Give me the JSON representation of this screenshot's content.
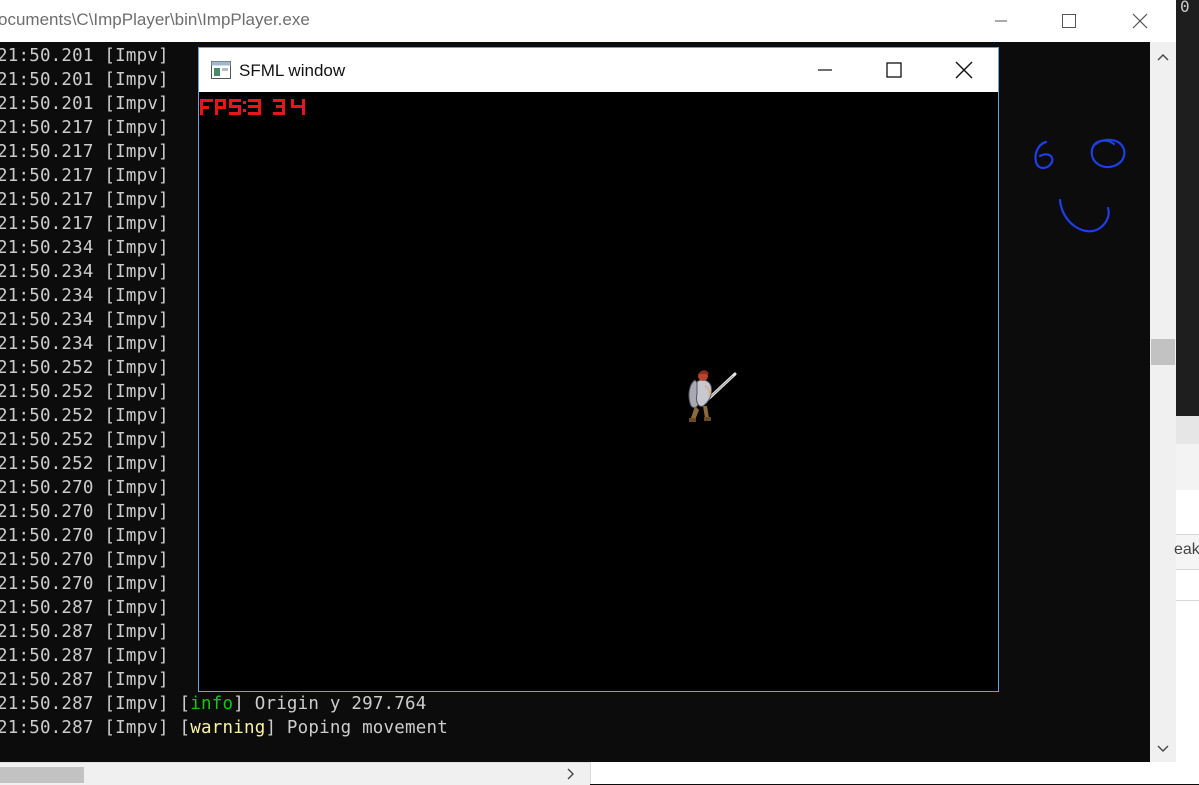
{
  "console_window": {
    "title": "ocuments\\C\\ImpPlayer\\bin\\ImpPlayer.exe",
    "controls": [
      "minimize",
      "maximize",
      "close"
    ]
  },
  "log_lines": [
    {
      "time": "21:50.201",
      "source": "[Impv]",
      "level": "",
      "message": ""
    },
    {
      "time": "21:50.201",
      "source": "[Impv]",
      "level": "",
      "message": ""
    },
    {
      "time": "21:50.201",
      "source": "[Impv]",
      "level": "",
      "message": ""
    },
    {
      "time": "21:50.217",
      "source": "[Impv]",
      "level": "",
      "message": ""
    },
    {
      "time": "21:50.217",
      "source": "[Impv]",
      "level": "",
      "message": ""
    },
    {
      "time": "21:50.217",
      "source": "[Impv]",
      "level": "",
      "message": ""
    },
    {
      "time": "21:50.217",
      "source": "[Impv]",
      "level": "",
      "message": ""
    },
    {
      "time": "21:50.217",
      "source": "[Impv]",
      "level": "",
      "message": ""
    },
    {
      "time": "21:50.234",
      "source": "[Impv]",
      "level": "",
      "message": ""
    },
    {
      "time": "21:50.234",
      "source": "[Impv]",
      "level": "",
      "message": ""
    },
    {
      "time": "21:50.234",
      "source": "[Impv]",
      "level": "",
      "message": ""
    },
    {
      "time": "21:50.234",
      "source": "[Impv]",
      "level": "",
      "message": ""
    },
    {
      "time": "21:50.234",
      "source": "[Impv]",
      "level": "",
      "message": ""
    },
    {
      "time": "21:50.252",
      "source": "[Impv]",
      "level": "",
      "message": ""
    },
    {
      "time": "21:50.252",
      "source": "[Impv]",
      "level": "",
      "message": ""
    },
    {
      "time": "21:50.252",
      "source": "[Impv]",
      "level": "",
      "message": ""
    },
    {
      "time": "21:50.252",
      "source": "[Impv]",
      "level": "",
      "message": ""
    },
    {
      "time": "21:50.252",
      "source": "[Impv]",
      "level": "",
      "message": ""
    },
    {
      "time": "21:50.270",
      "source": "[Impv]",
      "level": "",
      "message": ""
    },
    {
      "time": "21:50.270",
      "source": "[Impv]",
      "level": "",
      "message": ""
    },
    {
      "time": "21:50.270",
      "source": "[Impv]",
      "level": "",
      "message": ""
    },
    {
      "time": "21:50.270",
      "source": "[Impv]",
      "level": "",
      "message": ""
    },
    {
      "time": "21:50.270",
      "source": "[Impv]",
      "level": "",
      "message": ""
    },
    {
      "time": "21:50.287",
      "source": "[Impv]",
      "level": "",
      "message": ""
    },
    {
      "time": "21:50.287",
      "source": "[Impv]",
      "level": "",
      "message": ""
    },
    {
      "time": "21:50.287",
      "source": "[Impv]",
      "level": "",
      "message": ""
    },
    {
      "time": "21:50.287",
      "source": "[Impv]",
      "level": "",
      "message": ""
    },
    {
      "time": "21:50.287",
      "source": "[Impv]",
      "level": "info",
      "message": "Origin y 297.764"
    },
    {
      "time": "21:50.287",
      "source": "[Impv]",
      "level": "warning",
      "message": "Poping movement"
    }
  ],
  "sfml_window": {
    "title": "SFML window",
    "fps_text": "FPS: 34",
    "controls": [
      "minimize",
      "maximize",
      "close"
    ]
  },
  "background_app": {
    "edge_char": "0",
    "edge_text": "eak"
  },
  "colors": {
    "info": "#16c60c",
    "warning": "#f9f1a5",
    "fps_text": "#e8161b",
    "doodle": "#1f3fe6"
  },
  "icons": {
    "scroll_up": "chevron-up-icon",
    "scroll_down": "chevron-down-icon",
    "scroll_right": "chevron-right-icon"
  }
}
